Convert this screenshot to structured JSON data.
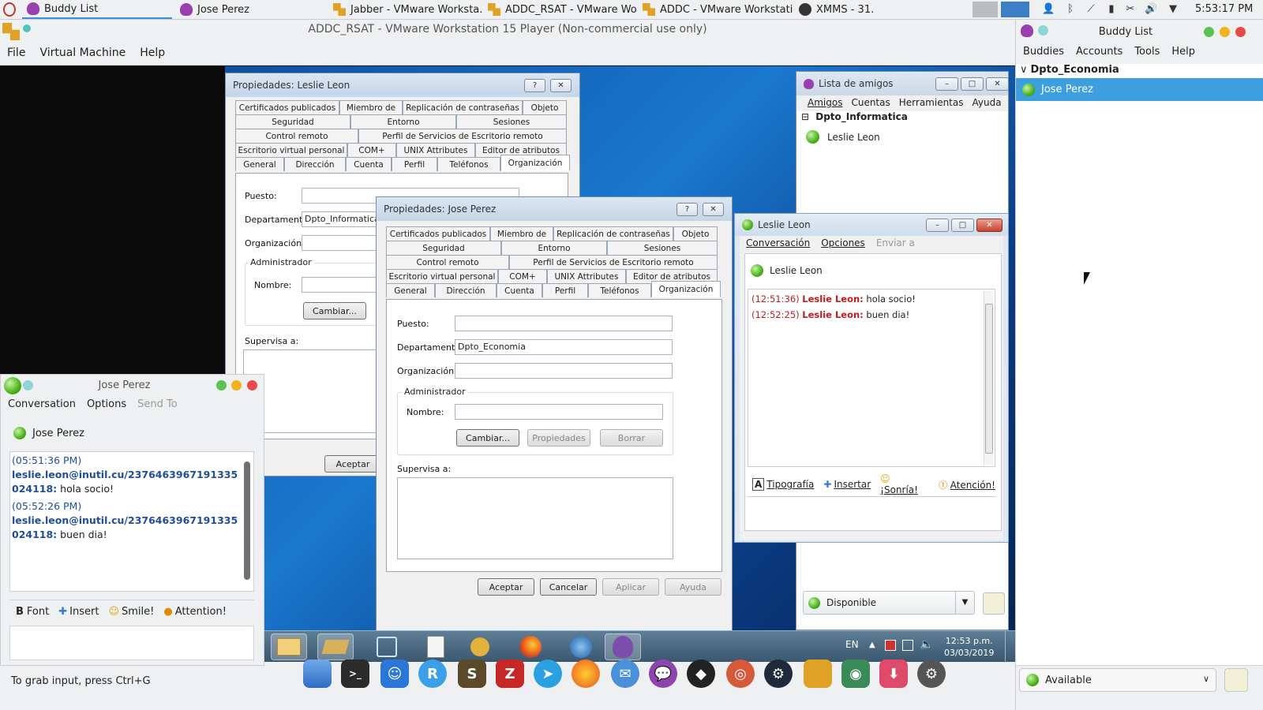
{
  "host_taskbar": {
    "tasks": [
      {
        "label": "Buddy List"
      },
      {
        "label": "Jose Perez"
      },
      {
        "label": "Jabber - VMware Worksta..."
      },
      {
        "label": "ADDC_RSAT - VMware Wo..."
      },
      {
        "label": "ADDC - VMware Workstati..."
      },
      {
        "label": "XMMS - 31."
      }
    ],
    "clock": "5:53:17 PM",
    "tray_icons": [
      "user-icon",
      "bluetooth-icon",
      "network-off-icon",
      "battery-icon",
      "tools-icon",
      "volume-icon",
      "dropdown-icon"
    ]
  },
  "vmware": {
    "title": "ADDC_RSAT - VMware Workstation 15 Player (Non-commercial use only)",
    "menu": [
      "File",
      "Virtual Machine",
      "Help"
    ],
    "status": "To grab input, press Ctrl+G"
  },
  "tabs": {
    "row1": [
      "Certificados publicados",
      "Miembro de",
      "Replicación de contraseñas",
      "Objeto"
    ],
    "row2": [
      "Seguridad",
      "Entorno",
      "Sesiones"
    ],
    "row3": [
      "Control remoto",
      "Perfil de Servicios de Escritorio remoto"
    ],
    "row4": [
      "Escritorio virtual personal",
      "COM+",
      "UNIX Attributes",
      "Editor de atributos"
    ],
    "row5": [
      "General",
      "Dirección",
      "Cuenta",
      "Perfil",
      "Teléfonos",
      "Organización"
    ]
  },
  "props_leslie": {
    "title": "Propiedades: Leslie Leon",
    "help_btn": "?",
    "close_btn": "✕",
    "puesto_label": "Puesto:",
    "depto_label": "Departamento:",
    "depto_value": "Dpto_Informatica",
    "org_label": "Organización:",
    "admin_label": "Administrador",
    "nombre_label": "Nombre:",
    "cambiar": "Cambiar...",
    "supervisa_label": "Supervisa a:",
    "aceptar": "Aceptar"
  },
  "props_jose": {
    "title": "Propiedades: Jose Perez",
    "help_btn": "?",
    "close_btn": "✕",
    "puesto_label": "Puesto:",
    "depto_label": "Departamento:",
    "depto_value": "Dpto_Economia",
    "org_label": "Organización:",
    "admin_label": "Administrador",
    "nombre_label": "Nombre:",
    "cambiar": "Cambiar...",
    "propiedades": "Propiedades",
    "borrar": "Borrar",
    "supervisa_label": "Supervisa a:",
    "aceptar": "Aceptar",
    "cancelar": "Cancelar",
    "aplicar": "Aplicar",
    "ayuda": "Ayuda"
  },
  "lista_amigos": {
    "title": "Lista de amigos",
    "menu": [
      "Amigos",
      "Cuentas",
      "Herramientas",
      "Ayuda"
    ],
    "group": "Dpto_Informatica",
    "group_toggle": "⊟",
    "buddy": "Leslie Leon",
    "status": "Disponible"
  },
  "chat_leslie": {
    "title": "Leslie Leon",
    "menu": [
      "Conversación",
      "Opciones",
      "Enviar a"
    ],
    "contact": "Leslie Leon",
    "messages": [
      {
        "time": "(12:51:36)",
        "nick": "Leslie Leon:",
        "text": "hola socio!"
      },
      {
        "time": "(12:52:25)",
        "nick": "Leslie Leon:",
        "text": "buen dia!"
      }
    ],
    "toolbar": [
      "Tipografía",
      "Insertar",
      "¡Sonría!",
      "Atención!"
    ]
  },
  "guest_taskbar": {
    "lang": "EN",
    "time": "12:53 p.m.",
    "date": "03/03/2019"
  },
  "chat_jose": {
    "title": "Jose Perez",
    "menu": [
      "Conversation",
      "Options",
      "Send To"
    ],
    "contact": "Jose Perez",
    "messages": [
      {
        "time": "(05:51:36 PM)",
        "nick": "leslie.leon@inutil.cu/2376463967191335024118:",
        "text": "hola socio!"
      },
      {
        "time": "(05:52:26 PM)",
        "nick": "leslie.leon@inutil.cu/2376463967191335024118:",
        "text": "buen dia!"
      }
    ],
    "toolbar": [
      "Font",
      "Insert",
      "Smile!",
      "Attention!"
    ]
  },
  "buddy_list": {
    "title": "Buddy List",
    "menu": [
      "Buddies",
      "Accounts",
      "Tools",
      "Help"
    ],
    "group": "Dpto_Economia",
    "group_toggle": "∨",
    "buddy": "Jose Perez",
    "status": "Available"
  },
  "colors": {
    "selection": "#3d9fe0",
    "status_green": "#4ab21d",
    "nick_blue": "#1f4e9b",
    "nick_red": "#c21b1b"
  }
}
